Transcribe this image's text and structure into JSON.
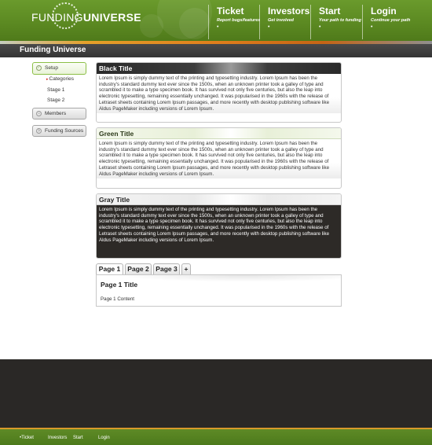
{
  "header": {
    "logo_thin": "FUNDING",
    "logo_bold": "UNIVERSE",
    "nav": [
      {
        "title": "Ticket",
        "subtitle": "Report bugs/features"
      },
      {
        "title": "Investors",
        "subtitle": "Get involved"
      },
      {
        "title": "Start",
        "subtitle": "Your path to funding"
      },
      {
        "title": "Login",
        "subtitle": "Continue your path"
      }
    ],
    "nav_bullet": "•"
  },
  "titlebar": {
    "title": "Funding Universe"
  },
  "sidebar": {
    "setup_label": "Setup",
    "sub_items": [
      {
        "label": "Categories",
        "marker": "▸"
      },
      {
        "label": "Stage 1"
      },
      {
        "label": "Stage 2"
      }
    ],
    "members_label": "Members",
    "funding_sources_label": "Funding Sources"
  },
  "panels": [
    {
      "title": "Black Title",
      "body": "Lorem Ipsum is simply dummy text of the printing and typesetting industry. Lorem Ipsum has been the industry's standard dummy text ever since the 1500s, when an unknown printer took a galley of type and scrambled it to make a type specimen book. It has survived not only five centuries, but also the leap into electronic typesetting, remaining essentially unchanged. It was popularised in the 1960s with the release of Letraset sheets containing Lorem Ipsum passages, and more recently with desktop publishing software like Aldus PageMaker including versions of Lorem Ipsum."
    },
    {
      "title": "Green Title",
      "body": "Lorem Ipsum is simply dummy text of the printing and typesetting industry. Lorem Ipsum has been the industry's standard dummy text ever since the 1500s, when an unknown printer took a galley of type and scrambled it to make a type specimen book. It has survived not only five centuries, but also the leap into electronic typesetting, remaining essentially unchanged. It was popularised in the 1960s with the release of Letraset sheets containing Lorem Ipsum passages, and more recently with desktop publishing software like Aldus PageMaker including versions of Lorem Ipsum."
    },
    {
      "title": "Gray Title",
      "body": "Lorem Ipsum is simply dummy text of the printing and typesetting industry. Lorem Ipsum has been the industry's standard dummy text ever since the 1500s, when an unknown printer took a galley of type and scrambled it to make a type specimen book. It has survived not only five centuries, but also the leap into electronic typesetting, remaining essentially unchanged. It was popularised in the 1960s with the release of Letraset sheets containing Lorem Ipsum passages, and more recently with desktop publishing software like Aldus PageMaker including versions of Lorem Ipsum."
    }
  ],
  "tabs": {
    "items": [
      "Page 1",
      "Page 2",
      "Page 3",
      "+"
    ],
    "active_index": 0,
    "content_title": "Page 1 Title",
    "content_body": "Page 1 Content"
  },
  "footer": {
    "bullet": "•",
    "links": [
      "Ticket",
      "Investors",
      "Start",
      "Login"
    ]
  },
  "colors": {
    "brand_green": "#5c8a22",
    "accent_orange": "#e07e1c",
    "dark_footer": "#2a2826",
    "marker_red": "#d8231a"
  }
}
